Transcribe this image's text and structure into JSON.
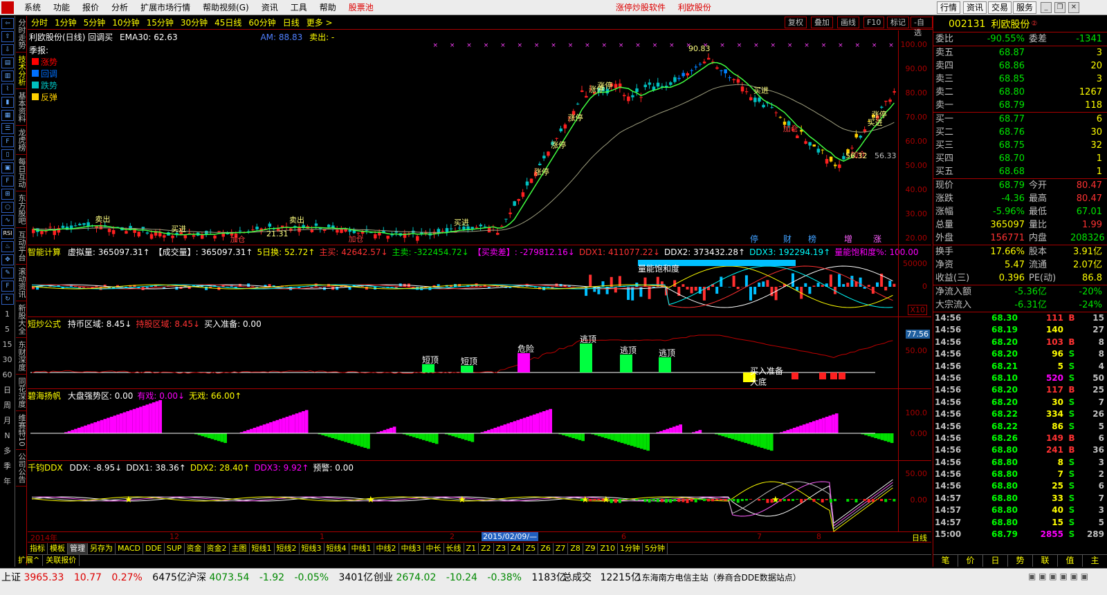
{
  "menubar": {
    "items": [
      "系统",
      "功能",
      "报价",
      "分析",
      "扩展市场行情",
      "帮助视频(G)",
      "资讯",
      "工具",
      "帮助"
    ],
    "pool": "股票池",
    "center_links": [
      "涨停炒股软件",
      "利欧股份"
    ],
    "right_buttons": [
      "行情",
      "资讯",
      "交易",
      "服务"
    ]
  },
  "left_vertical_tabs": [
    "分时走势",
    "技术分析",
    "基本资料",
    "龙虎榜",
    "每日互动",
    "东方股吧",
    "互动平台",
    "滚动资讯",
    "新股大全",
    "东财深度",
    "同花深度",
    "维赛特10",
    "公司公告"
  ],
  "left_period_labels": [
    "1",
    "5",
    "15",
    "30",
    "60",
    "日",
    "周",
    "月",
    "N",
    "多",
    "季",
    "年"
  ],
  "periods": {
    "items": [
      "分时",
      "1分钟",
      "5分钟",
      "10分钟",
      "15分钟",
      "30分钟",
      "45日线",
      "60分钟",
      "日线",
      "更多 >"
    ],
    "right": [
      "复权",
      "叠加",
      "画线",
      "F10",
      "标记",
      "-自选"
    ]
  },
  "main_panel": {
    "title": "利欧股份(日线) 回调买",
    "ema": "EMA30: 62.63",
    "am": "AM: 88.83",
    "sell": "卖出: -",
    "legend_title": "季报:",
    "legend": [
      {
        "label": "涨势",
        "color": "#ff0000"
      },
      {
        "label": "回调",
        "color": "#0070ff"
      },
      {
        "label": "跌势",
        "color": "#00c0c0"
      },
      {
        "label": "反弹",
        "color": "#ffd000"
      }
    ],
    "axis": [
      "100.00",
      "90.00",
      "80.00",
      "70.00",
      "60.00",
      "50.00",
      "40.00",
      "30.00",
      "20.00"
    ],
    "marks": [
      "停",
      "财",
      "榜",
      "增",
      "涨"
    ],
    "signals": {
      "up": "涨停",
      "buy": "买进",
      "sell": "卖出",
      "add": "加仓",
      "chase": "追半"
    },
    "annot_high": "90.83",
    "annot_mid": "56.32",
    "annot_level": "56.33",
    "annot_low": "21.31"
  },
  "panel2": {
    "name": "智能计算",
    "fields": [
      {
        "t": "虚拟量: 365097.31↑",
        "c": "white"
      },
      {
        "t": "【成交量】: 365097.31↑",
        "c": "white"
      },
      {
        "t": "5日换: 52.72↑",
        "c": "yellow"
      },
      {
        "t": "主买: 42642.57↓",
        "c": "red"
      },
      {
        "t": "主卖: -322454.72↓",
        "c": "green"
      },
      {
        "t": "【买卖差】: -279812.16↓",
        "c": "mag"
      },
      {
        "t": "DDX1: 411077.22↓",
        "c": "red"
      },
      {
        "t": "DDX2: 373432.28↑",
        "c": "white"
      },
      {
        "t": "DDX3: 192294.19↑",
        "c": "cyan"
      },
      {
        "t": "量能饱和度%: 100.00",
        "c": "mag"
      }
    ],
    "saturation_label": "量能饱和度",
    "axis": [
      "50000",
      "0"
    ],
    "unit": "X10"
  },
  "panel3": {
    "name": "短炒公式",
    "fields": [
      {
        "t": "持币区域: 8.45↓",
        "c": "white"
      },
      {
        "t": "持股区域: 8.45↓",
        "c": "red"
      },
      {
        "t": "买入准备: 0.00",
        "c": "white"
      }
    ],
    "labels": [
      "短顶",
      "短顶",
      "危险",
      "逃顶",
      "逃顶",
      "逃顶",
      "买入准备",
      "大底"
    ],
    "axis": [
      "77.56",
      "50.00"
    ]
  },
  "panel4": {
    "name": "碧海扬帆",
    "fields": [
      {
        "t": "大盘强势区: 0.00",
        "c": "white"
      },
      {
        "t": "有戏: 0.00↓",
        "c": "mag"
      },
      {
        "t": "无戏: 66.00↑",
        "c": "yellow"
      }
    ],
    "axis": [
      "100.0",
      "0.00"
    ]
  },
  "panel5": {
    "name": "千钧DDX",
    "fields": [
      {
        "t": "DDX: -8.95↓",
        "c": "white"
      },
      {
        "t": "DDX1: 38.36↑",
        "c": "white"
      },
      {
        "t": "DDX2: 28.40↑",
        "c": "yellow"
      },
      {
        "t": "DDX3: 9.92↑",
        "c": "mag"
      },
      {
        "t": "预警: 0.00",
        "c": "white"
      }
    ],
    "axis": [
      "50.00",
      "0.00"
    ]
  },
  "time_axis": {
    "labels": [
      "2014年",
      "12",
      "1",
      "2",
      "2015/02/09/—",
      "6",
      "7",
      "8"
    ],
    "right": "日线"
  },
  "index_tabs": [
    "指标",
    "模板",
    "管理",
    "另存为",
    "MACD",
    "DDE",
    "SUP",
    "资金",
    "资金2",
    "主图",
    "短线1",
    "短线2",
    "短线3",
    "短线4",
    "中线1",
    "中线2",
    "中线3",
    "中长",
    "长线",
    "Z1",
    "Z2",
    "Z3",
    "Z4",
    "Z5",
    "Z6",
    "Z7",
    "Z8",
    "Z9",
    "Z10",
    "1分钟",
    "5分钟"
  ],
  "ext_tabs": [
    "扩展^",
    "关联报价"
  ],
  "quote": {
    "code": "002131",
    "name": "利欧股份",
    "weibi_label": "委比",
    "weibi": "-90.55%",
    "weicha_label": "委差",
    "weicha": "-1341",
    "asks": [
      {
        "l": "卖五",
        "p": "68.87",
        "v": "3"
      },
      {
        "l": "卖四",
        "p": "68.86",
        "v": "20"
      },
      {
        "l": "卖三",
        "p": "68.85",
        "v": "3"
      },
      {
        "l": "卖二",
        "p": "68.80",
        "v": "1267"
      },
      {
        "l": "卖一",
        "p": "68.79",
        "v": "118"
      }
    ],
    "bids": [
      {
        "l": "买一",
        "p": "68.77",
        "v": "6"
      },
      {
        "l": "买二",
        "p": "68.76",
        "v": "30"
      },
      {
        "l": "买三",
        "p": "68.75",
        "v": "32"
      },
      {
        "l": "买四",
        "p": "68.70",
        "v": "1"
      },
      {
        "l": "买五",
        "p": "68.68",
        "v": "1"
      }
    ],
    "stats": [
      {
        "a": "现价",
        "b": "68.79",
        "bc": "green",
        "c": "今开",
        "d": "80.47",
        "dc": "red"
      },
      {
        "a": "涨跌",
        "b": "-4.36",
        "bc": "green",
        "c": "最高",
        "d": "80.47",
        "dc": "red"
      },
      {
        "a": "涨幅",
        "b": "-5.96%",
        "bc": "green",
        "c": "最低",
        "d": "67.01",
        "dc": "green"
      },
      {
        "a": "总量",
        "b": "365097",
        "bc": "yellow",
        "c": "量比",
        "d": "1.99",
        "dc": "red"
      },
      {
        "a": "外盘",
        "b": "156771",
        "bc": "red",
        "c": "内盘",
        "d": "208326",
        "dc": "green"
      }
    ],
    "stats2": [
      {
        "a": "换手",
        "b": "17.66%",
        "bc": "yellow",
        "c": "股本",
        "d": "3.91亿",
        "dc": "yellow"
      },
      {
        "a": "净资",
        "b": "5.47",
        "bc": "yellow",
        "c": "流通",
        "d": "2.07亿",
        "dc": "yellow"
      },
      {
        "a": "收益(三)",
        "b": "0.396",
        "bc": "yellow",
        "c": "PE(动)",
        "d": "86.8",
        "dc": "yellow"
      }
    ],
    "flows": [
      {
        "a": "净流入额",
        "b": "-5.36亿",
        "c": "-20%"
      },
      {
        "a": "大宗流入",
        "b": "-6.31亿",
        "c": "-24%"
      }
    ],
    "ticks": [
      {
        "t": "14:56",
        "p": "68.30",
        "v": "111",
        "bs": "B",
        "n": "15"
      },
      {
        "t": "14:56",
        "p": "68.19",
        "v": "140",
        "bs": "",
        "n": "27"
      },
      {
        "t": "14:56",
        "p": "68.20",
        "v": "103",
        "bs": "B",
        "n": "8"
      },
      {
        "t": "14:56",
        "p": "68.20",
        "v": "96",
        "bs": "S",
        "n": "8"
      },
      {
        "t": "14:56",
        "p": "68.21",
        "v": "5",
        "bs": "S",
        "n": "4"
      },
      {
        "t": "14:56",
        "p": "68.10",
        "v": "520",
        "bs": "S",
        "n": "50"
      },
      {
        "t": "14:56",
        "p": "68.20",
        "v": "117",
        "bs": "B",
        "n": "25"
      },
      {
        "t": "14:56",
        "p": "68.20",
        "v": "30",
        "bs": "S",
        "n": "7"
      },
      {
        "t": "14:56",
        "p": "68.22",
        "v": "334",
        "bs": "S",
        "n": "26"
      },
      {
        "t": "14:56",
        "p": "68.22",
        "v": "86",
        "bs": "S",
        "n": "5"
      },
      {
        "t": "14:56",
        "p": "68.26",
        "v": "149",
        "bs": "B",
        "n": "6"
      },
      {
        "t": "14:56",
        "p": "68.80",
        "v": "241",
        "bs": "B",
        "n": "36"
      },
      {
        "t": "14:56",
        "p": "68.80",
        "v": "8",
        "bs": "S",
        "n": "3"
      },
      {
        "t": "14:56",
        "p": "68.80",
        "v": "7",
        "bs": "S",
        "n": "2"
      },
      {
        "t": "14:56",
        "p": "68.80",
        "v": "25",
        "bs": "S",
        "n": "6"
      },
      {
        "t": "14:57",
        "p": "68.80",
        "v": "33",
        "bs": "S",
        "n": "7"
      },
      {
        "t": "14:57",
        "p": "68.80",
        "v": "40",
        "bs": "S",
        "n": "3"
      },
      {
        "t": "14:57",
        "p": "68.80",
        "v": "15",
        "bs": "S",
        "n": "5"
      },
      {
        "t": "15:00",
        "p": "68.79",
        "v": "2855",
        "bs": "S",
        "n": "289"
      }
    ],
    "tabs": [
      "笔",
      "价",
      "日",
      "势",
      "联",
      "值",
      "主"
    ]
  },
  "status": {
    "sh": {
      "l": "上证",
      "p": "3965.33",
      "c": "10.77",
      "pct": "0.27%",
      "amt": "6475亿"
    },
    "hs": {
      "l": "沪深",
      "p": "4073.54",
      "c": "-1.92",
      "pct": "-0.05%",
      "amt": "3401亿"
    },
    "cy": {
      "l": "创业",
      "p": "2674.02",
      "c": "-10.24",
      "pct": "-0.38%",
      "amt": "1183亿"
    },
    "total_label": "总成交",
    "total": "12215亿",
    "site": "1东海南方电信主站（券商合DDE数据站点）"
  }
}
